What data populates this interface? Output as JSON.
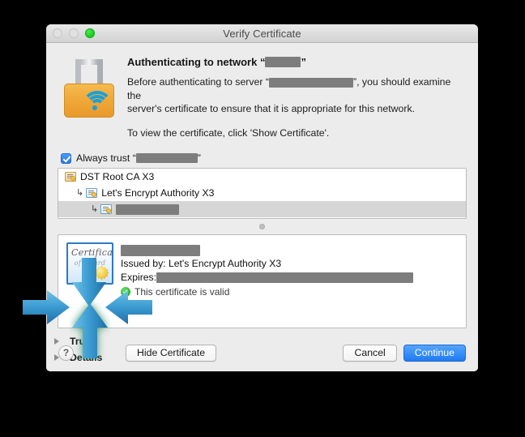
{
  "window": {
    "title": "Verify Certificate",
    "traffic_lights": [
      {
        "name": "close",
        "state": "disabled"
      },
      {
        "name": "minimize",
        "state": "disabled"
      },
      {
        "name": "zoom",
        "state": "green"
      }
    ]
  },
  "header": {
    "icon": "wifi-lock-icon",
    "headline_prefix": "Authenticating to network “",
    "headline_suffix": "”",
    "headline_redacted_width": 44,
    "paragraph1_part1": "Before authenticating to server “",
    "paragraph1_redacted_width": 104,
    "paragraph1_part2": "”, you should examine the",
    "paragraph1_line2": "server's certificate to ensure that it is appropriate for this network.",
    "paragraph2": "To view the certificate, click 'Show Certificate'."
  },
  "always_trust": {
    "checked": true,
    "label_prefix": "Always trust “",
    "label_suffix": "”",
    "redacted_width": 76
  },
  "tree": {
    "rows": [
      {
        "label": "DST Root CA X3",
        "level": 0,
        "icon": "certificate-root-icon",
        "selected": false,
        "redacted": false
      },
      {
        "label": "Let's Encrypt Authority X3",
        "level": 1,
        "icon": "certificate-icon",
        "selected": false,
        "redacted": false
      },
      {
        "label": "",
        "level": 2,
        "icon": "certificate-icon",
        "selected": true,
        "redacted": true,
        "redacted_width": 78
      }
    ]
  },
  "certificate": {
    "icon": "certificate-seal-icon",
    "icon_caption": "Certificate",
    "icon_subcaption": "of Award",
    "name_redacted_width": 98,
    "issued_by_label": "Issued by: Let's Encrypt Authority X3",
    "expires_label": "Expires:",
    "expires_redacted_width": 317,
    "validity_text": "This certificate is valid",
    "validity_state": "valid"
  },
  "disclosures": [
    {
      "label": "Trust",
      "expanded": false
    },
    {
      "label": "Details",
      "expanded": false
    }
  ],
  "footer": {
    "help_label": "?",
    "hide_certificate_label": "Hide Certificate",
    "cancel_label": "Cancel",
    "continue_label": "Continue"
  },
  "annotations": {
    "arrows": [
      {
        "name": "arrow-left-to-trust",
        "direction": "right",
        "color": "#3a93c9"
      },
      {
        "name": "arrow-right-to-trust",
        "direction": "left",
        "color": "#3a93c9"
      },
      {
        "name": "arrow-top-to-trust",
        "direction": "down",
        "color": "#3a93c9"
      },
      {
        "name": "arrow-bottom-to-details",
        "direction": "up",
        "color": "#3a93c9",
        "glow": "#2f8f5e"
      }
    ]
  },
  "colors": {
    "accent": "#1f7bf3",
    "redaction": "#7d7d7d",
    "valid_green": "#21b42a",
    "window_bg": "#ececec",
    "page_bg": "#000000"
  }
}
